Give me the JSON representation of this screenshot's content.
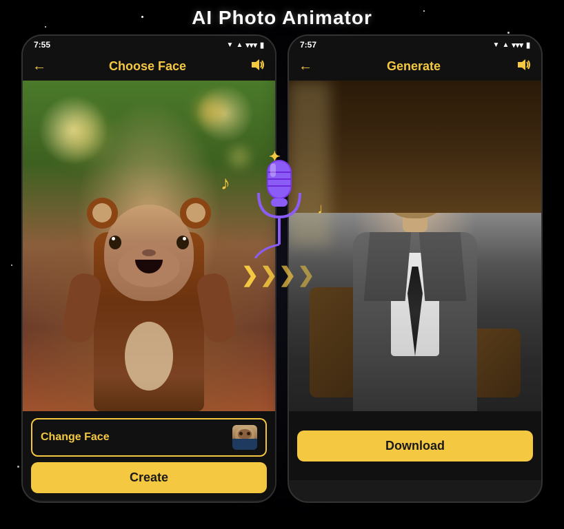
{
  "app": {
    "title": "AI Photo Animator"
  },
  "left_phone": {
    "status_time": "7:55",
    "nav_title": "Choose Face",
    "back_icon": "←",
    "sound_icon": "🔊",
    "change_face_label": "Change Face",
    "create_label": "Create"
  },
  "right_phone": {
    "status_time": "7:57",
    "nav_title": "Generate",
    "back_icon": "←",
    "sound_icon": "🔊",
    "download_label": "Download"
  },
  "overlay": {
    "sparkle": "✦",
    "music_note_1": "♪",
    "music_note_2": "♩",
    "arrows": [
      "❯",
      "❯",
      "❯",
      "❯"
    ]
  },
  "status_icons": {
    "signal": "▼▲",
    "wifi": "WiFi",
    "battery": "🔋"
  }
}
